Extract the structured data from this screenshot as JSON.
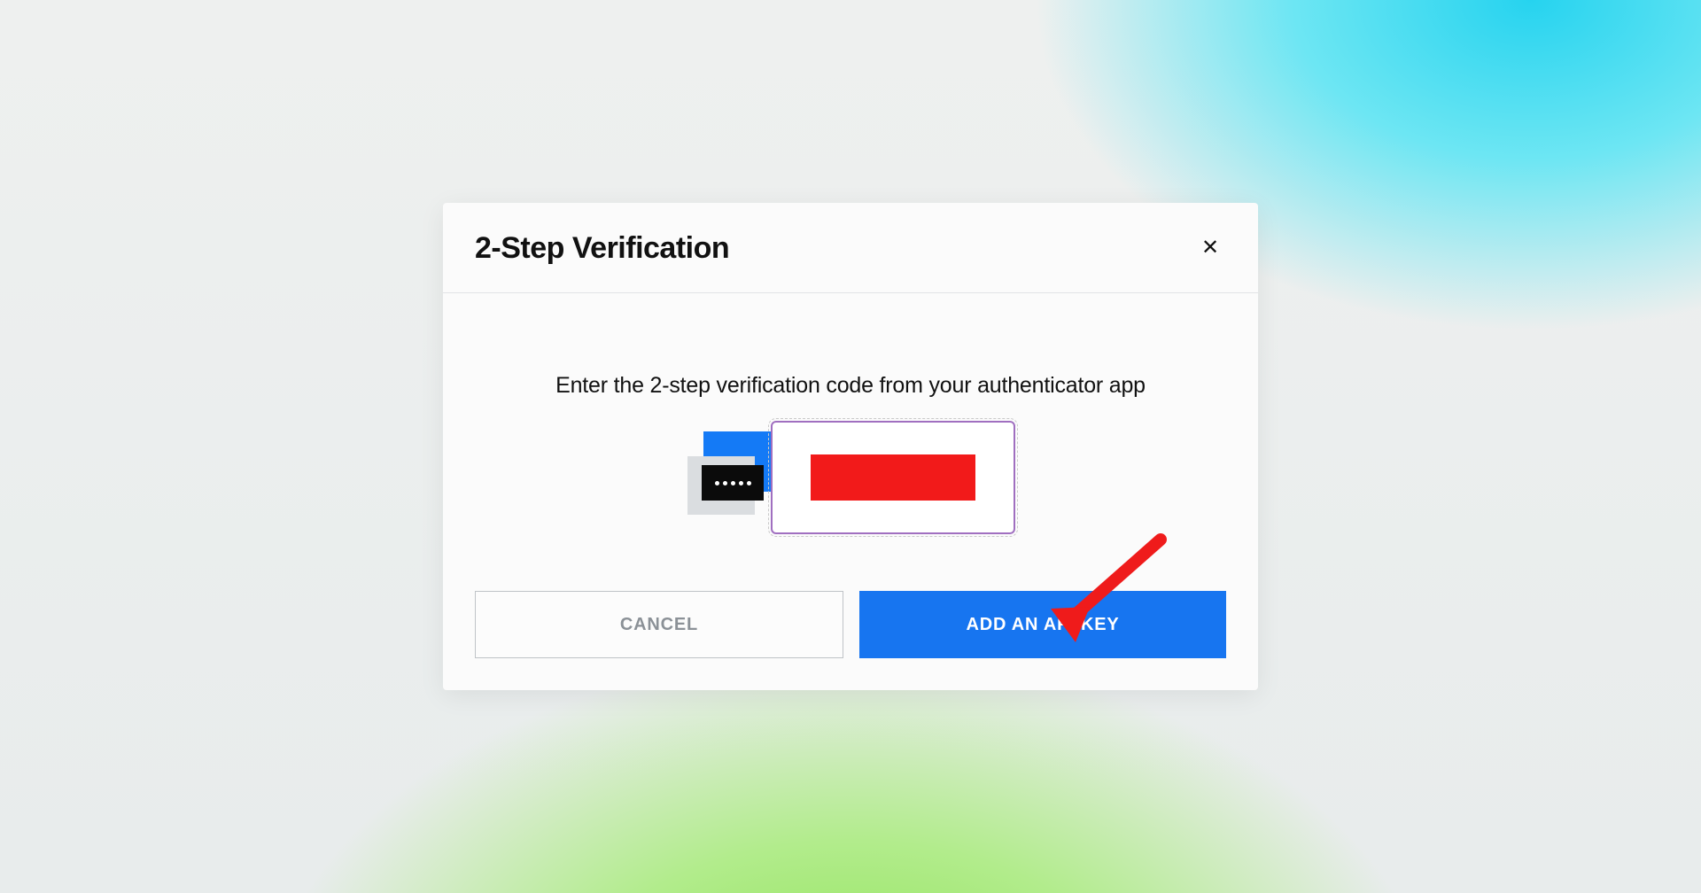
{
  "dialog": {
    "title": "2-Step Verification",
    "close_label": "✕",
    "instruction": "Enter the 2-step verification code from your authenticator app",
    "code_input": {
      "value_redacted": true,
      "placeholder": ""
    },
    "buttons": {
      "cancel_label": "CANCEL",
      "primary_label": "ADD AN API KEY"
    }
  },
  "annotation": {
    "arrow_color": "#ef1b1b",
    "points_to": "add-api-key-button"
  },
  "colors": {
    "primary_blue": "#1775f0",
    "redact_red": "#f21a1a",
    "input_border": "#a06fc0"
  }
}
